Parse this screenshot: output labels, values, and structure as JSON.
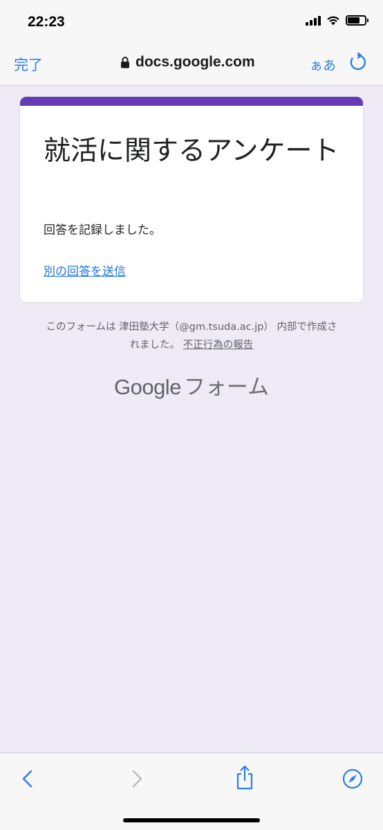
{
  "status_bar": {
    "time": "22:23",
    "icons": [
      "cellular-signal-icon",
      "wifi-icon",
      "battery-icon"
    ]
  },
  "nav": {
    "done_label": "完了",
    "url": "docs.google.com",
    "text_size_label": "ぁあ",
    "icons": [
      "lock-icon",
      "reload-icon"
    ]
  },
  "form": {
    "accent_color": "#673ab7",
    "title": "就活に関するアンケート",
    "confirmation": "回答を記録しました。",
    "submit_another": "別の回答を送信"
  },
  "footer": {
    "note_line1": "このフォームは 津田塾大学（@gm.tsuda.ac.jp） 内部で作成さ",
    "note_line2": "れました。",
    "report_link": "不正行為の報告",
    "brand_google": "Google",
    "brand_forms": "フォーム"
  },
  "toolbar": {
    "icons": [
      "back-icon",
      "forward-icon",
      "share-icon",
      "compass-icon"
    ]
  }
}
